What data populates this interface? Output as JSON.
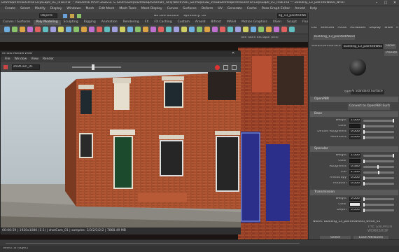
{
  "window": {
    "title": "DevelopmentExteriorCityscape_01_final.ma* - Autodesk MAYA 2020.2: C:\\Users\\tonys\\Desktop\\Groman_Tony\\work\\Part_02\\Maya\\3D_VisualDevelopmentExteriorCityscape_01_final.ma --- building_13_paintedWood_white_01"
  },
  "menubar": [
    "Create",
    "Select",
    "Modify",
    "Display",
    "Windows",
    "Mesh",
    "Edit Mesh",
    "Mesh Tools",
    "Mesh Display",
    "Curves",
    "Surfaces",
    "Deform",
    "UV",
    "Generate",
    "Cache",
    "Pose Graph Editor",
    "Arnold",
    "Help"
  ],
  "statusline": {
    "mode": "Objects",
    "live": "No Live Surface",
    "symmetry": "Symmetry: Off",
    "search": "sg_13_paintedWood_white_01",
    "workspace_label": "Workspace:",
    "workspace": "General*"
  },
  "shelf_tabs": [
    "Curves / Surfaces",
    "Poly Modeling",
    "Sculpting",
    "Rigging",
    "Animation",
    "Rendering",
    "FX",
    "FX Caching",
    "Custom",
    "Arnold",
    "Bifrost",
    "MASH",
    "Motion Graphics",
    "XGen",
    "Sculpt",
    "Fluids"
  ],
  "viewport_header": "dev room extrapol (WS)",
  "render_view": {
    "title": "Arnold RenderView",
    "menu": [
      "File",
      "Window",
      "View",
      "Render"
    ],
    "camera": "shotCam_01",
    "status": "00:00:59 | 1920x1080 (1:1) | shotCam_01 | samples: 3/3/2/2/2/2 | 7868.49 MB"
  },
  "right_panel": {
    "tabs": [
      "List",
      "Selected",
      "Focus",
      "Attributes",
      "Display",
      "Show",
      "Help"
    ],
    "node_tab": "building_13_paintedWood_white_01",
    "shader_label": "aiStandardSurface:",
    "shader_value": "building_13_paintedWood_white_01",
    "focus_btn": "Focus",
    "presets_btn": "Presets",
    "type_label": "Type",
    "type_value": "Ai Standard Surface",
    "openpbr_label": "OpenPBR",
    "convert_btn": "Convert to OpenPBR Surface",
    "sections": {
      "base": "Base",
      "specular": "Specular",
      "transmission": "Transmission"
    },
    "base_attrs": [
      {
        "label": "Weight",
        "value": "1.000",
        "fill": 1.0
      },
      {
        "label": "Color",
        "value": "",
        "fill": 0.0
      },
      {
        "label": "Diffuse Roughness",
        "value": "0.000",
        "fill": 0.0
      },
      {
        "label": "Metalness",
        "value": "0.000",
        "fill": 0.0
      }
    ],
    "spec_attrs": [
      {
        "label": "Weight",
        "value": "1.000",
        "fill": 1.0
      },
      {
        "label": "Color",
        "value": "",
        "fill": 0.0
      },
      {
        "label": "Roughness",
        "value": "0.480",
        "fill": 0.48
      },
      {
        "label": "IOR",
        "value": "1.500",
        "fill": 0.5
      },
      {
        "label": "Anisotropy",
        "value": "0.000",
        "fill": 0.0
      },
      {
        "label": "Rotation",
        "value": "0.000",
        "fill": 0.0
      }
    ],
    "trans_attrs": [
      {
        "label": "Weight",
        "value": "0.000",
        "fill": 0.0
      },
      {
        "label": "Color",
        "value": "",
        "fill": 0.0
      },
      {
        "label": "Depth",
        "value": "0.000",
        "fill": 0.0
      }
    ],
    "notes": "Notes: building_13_paintedWood_white_01",
    "select_btn": "Select",
    "load_btn": "Load Attributes",
    "watermark": "THE GNOMON WORKSHOP"
  },
  "command_line": "Select an object"
}
